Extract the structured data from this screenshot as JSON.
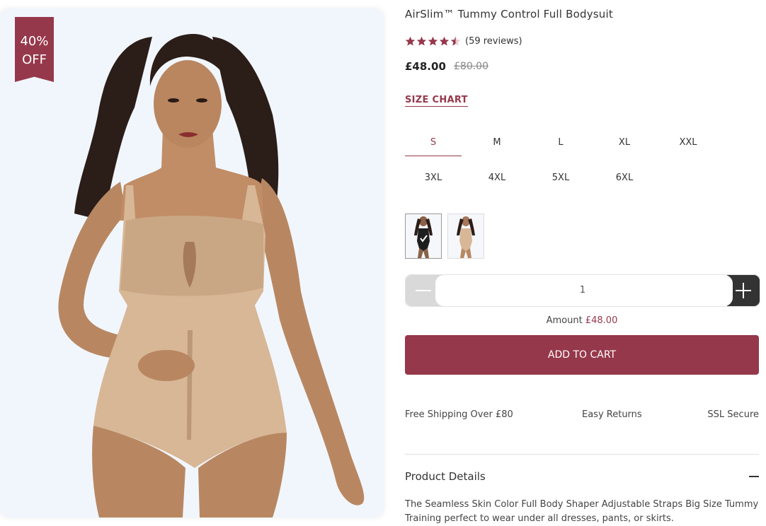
{
  "product_image": {
    "badge": {
      "line1": "40%",
      "line2": "OFF"
    }
  },
  "product": {
    "title": "AirSlim™ Tummy Control Full Bodysuit",
    "rating": 4.5,
    "reviews": "(59 reviews)",
    "price": "£48.00",
    "old_price": "£80.00",
    "size_chart_label": "SIZE CHART",
    "sizes": [
      "S",
      "M",
      "L",
      "XL",
      "XXL",
      "3XL",
      "4XL",
      "5XL",
      "6XL"
    ],
    "selected_size": "S",
    "colors": [
      {
        "name": "black",
        "icon": "black-bodysuit-swatch"
      },
      {
        "name": "skin",
        "icon": "nude-bodysuit-swatch"
      }
    ],
    "quantity": "1",
    "amount_label": "Amount",
    "amount_value": "£48.00",
    "add_to_cart_label": "ADD TO CART",
    "benefits": [
      "Free Shipping Over £80",
      "Easy Returns",
      "SSL Secure"
    ],
    "details_title": "Product Details",
    "details_text": "The Seamless Skin Color Full Body Shaper Adjustable Straps Big Size Tummy Training perfect to wear under all dresses, pants, or skirts."
  },
  "colors": {
    "accent": "#96384b",
    "star": "#96384b",
    "image_bg": "#f1f6fd",
    "plus_bg": "#333333"
  }
}
